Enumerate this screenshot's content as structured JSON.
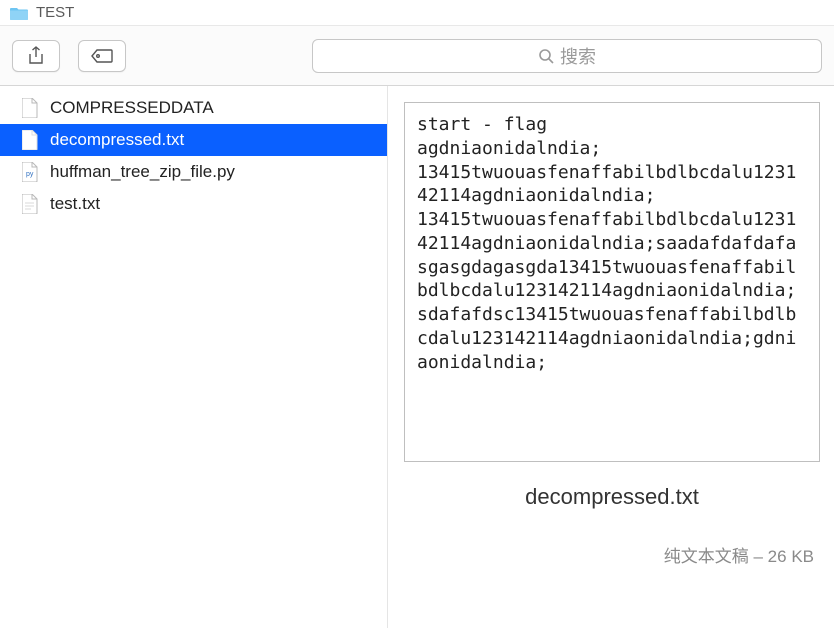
{
  "window": {
    "title": "TEST"
  },
  "search": {
    "placeholder": "搜索"
  },
  "files": [
    {
      "name": "COMPRESSEDDATA",
      "icon": "file",
      "selected": false
    },
    {
      "name": "decompressed.txt",
      "icon": "file",
      "selected": true
    },
    {
      "name": "huffman_tree_zip_file.py",
      "icon": "python",
      "selected": false
    },
    {
      "name": "test.txt",
      "icon": "file",
      "selected": false
    }
  ],
  "preview": {
    "text": "start - flag\nagdniaonidalndia;\n13415twuouasfenaffabilbdlbcdalu123142114agdniaonidalndia;\n13415twuouasfenaffabilbdlbcdalu123142114agdniaonidalndia;saadafdafdafasgasgdagasgda13415twuouasfenaffabilbdlbcdalu123142114agdniaonidalndia;sdafafdsc13415twuouasfenaffabilbdlbcdalu123142114agdniaonidalndia;gdniaonidalndia;",
    "filename": "decompressed.txt",
    "meta": "纯文本文稿 – 26 KB"
  }
}
